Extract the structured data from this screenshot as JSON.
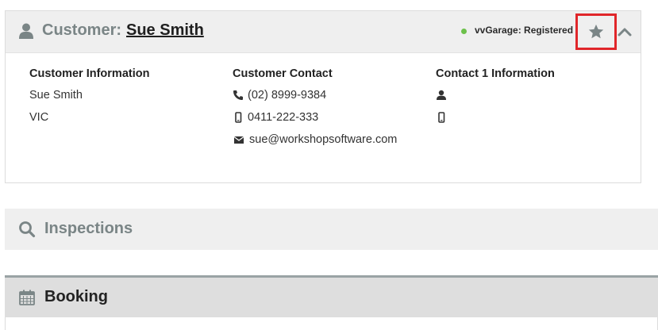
{
  "customer": {
    "prefix": "Customer:",
    "name": "Sue Smith",
    "status": "vvGarage: Registered",
    "status_color": "#6cc04a",
    "highlight_color": "#e0262a",
    "icons": {
      "header": "user-icon",
      "favorite": "star-icon",
      "collapse": "chevron-up-icon"
    },
    "info": {
      "heading": "Customer Information",
      "lines": [
        "Sue Smith",
        "VIC"
      ]
    },
    "contact": {
      "heading": "Customer Contact",
      "phone": "(02) 8999-9384",
      "mobile": "0411-222-333",
      "email": "sue@workshopsoftware.com"
    },
    "contact1": {
      "heading": "Contact 1 Information"
    }
  },
  "inspections": {
    "title": "Inspections",
    "icon": "search-icon"
  },
  "booking": {
    "title": "Booking",
    "icon": "calendar-icon"
  }
}
